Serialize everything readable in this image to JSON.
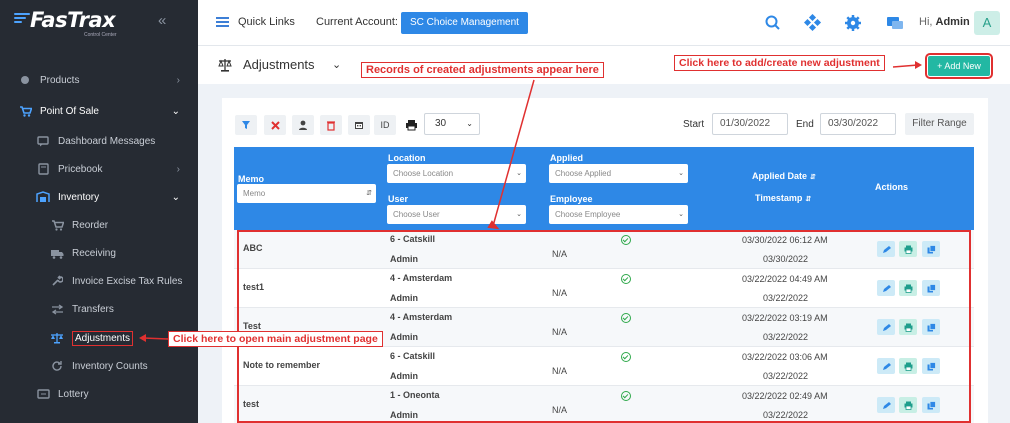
{
  "brand": {
    "name": "FasTrax",
    "sub": "Control Center"
  },
  "sidebar": {
    "items": [
      {
        "label": "Products",
        "icon": "circle-icon"
      },
      {
        "label": "Point Of Sale",
        "icon": "cart-icon"
      },
      {
        "label": "Dashboard Messages",
        "icon": "message-icon"
      },
      {
        "label": "Pricebook",
        "icon": "book-icon"
      },
      {
        "label": "Inventory",
        "icon": "warehouse-icon"
      },
      {
        "label": "Reorder",
        "icon": "cart-icon"
      },
      {
        "label": "Receiving",
        "icon": "truck-icon"
      },
      {
        "label": "Invoice Excise Tax Rules",
        "icon": "wrench-icon"
      },
      {
        "label": "Transfers",
        "icon": "exchange-icon"
      },
      {
        "label": "Adjustments",
        "icon": "scale-icon"
      },
      {
        "label": "Inventory Counts",
        "icon": "refresh-icon"
      },
      {
        "label": "Lottery",
        "icon": "ticket-icon"
      }
    ]
  },
  "topbar": {
    "quick_links": "Quick Links",
    "account_label": "Current Account:",
    "account_value": "SC Choice Management",
    "greeting": "Hi,",
    "user": "Admin",
    "avatar": "A"
  },
  "page": {
    "title": "Adjustments",
    "add_new": "+ Add New"
  },
  "toolbar": {
    "id_label": "ID",
    "page_size": "30",
    "start_label": "Start",
    "start_date": "01/30/2022",
    "end_label": "End",
    "end_date": "03/30/2022",
    "filter_label": "Filter Range"
  },
  "table": {
    "headers": {
      "memo": "Memo",
      "memo_placeholder": "Memo",
      "location": "Location",
      "location_placeholder": "Choose Location",
      "user": "User",
      "user_placeholder": "Choose User",
      "applied": "Applied",
      "applied_placeholder": "Choose Applied",
      "employee": "Employee",
      "employee_placeholder": "Choose Employee",
      "applied_date": "Applied Date",
      "timestamp": "Timestamp",
      "actions": "Actions"
    },
    "rows": [
      {
        "memo": "ABC",
        "location": "6 - Catskill",
        "user": "Admin",
        "employee": "N/A",
        "applied_date": "03/30/2022 06:12 AM",
        "timestamp": "03/30/2022"
      },
      {
        "memo": "test1",
        "location": "4 - Amsterdam",
        "user": "Admin",
        "employee": "N/A",
        "applied_date": "03/22/2022 04:49 AM",
        "timestamp": "03/22/2022"
      },
      {
        "memo": "Test",
        "location": "4 - Amsterdam",
        "user": "Admin",
        "employee": "N/A",
        "applied_date": "03/22/2022 03:19 AM",
        "timestamp": "03/22/2022"
      },
      {
        "memo": "Note to remember",
        "location": "6 - Catskill",
        "user": "Admin",
        "employee": "N/A",
        "applied_date": "03/22/2022 03:06 AM",
        "timestamp": "03/22/2022"
      },
      {
        "memo": "test",
        "location": "1 - Oneonta",
        "user": "Admin",
        "employee": "N/A",
        "applied_date": "03/22/2022 02:49 AM",
        "timestamp": "03/22/2022"
      }
    ]
  },
  "annotations": {
    "records": "Records of created adjustments appear here",
    "add": "Click here to add/create new adjustment",
    "open": "Click here to open main adjustment page"
  },
  "colors": {
    "sidebar": "#262b33",
    "primary": "#2e88e6",
    "teal": "#22b8a3",
    "annotation": "#e03030"
  }
}
